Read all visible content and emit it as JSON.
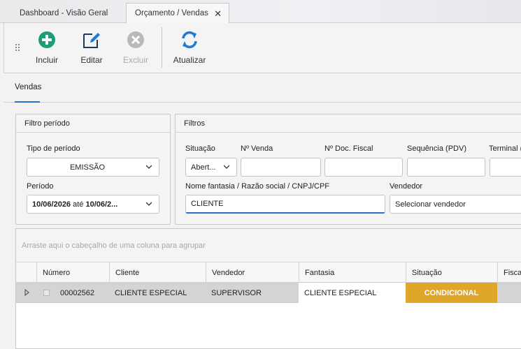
{
  "tabs": [
    {
      "label": "Dashboard - Visão Geral"
    },
    {
      "label": "Orçamento / Vendas",
      "close": "✕"
    }
  ],
  "toolbar": {
    "incluir": "Incluir",
    "editar": "Editar",
    "excluir": "Excluir",
    "atualizar": "Atualizar"
  },
  "page_tab": "Vendas",
  "periodo_group": {
    "title": "Filtro período",
    "tipo_label": "Tipo de período",
    "tipo_value": "EMISSÃO",
    "periodo_label": "Período",
    "periodo_from": "10/06/2026",
    "periodo_sep": " até ",
    "periodo_to": "10/06/2..."
  },
  "filtros_group": {
    "title": "Filtros",
    "situacao_label": "Situação",
    "situacao_value": "Abert...",
    "nvenda_label": "Nº Venda",
    "ndoc_label": "Nº Doc. Fiscal",
    "sequencia_label": "Sequência (PDV)",
    "terminal_label": "Terminal (",
    "nome_label": "Nome fantasia / Razão social / CNPJ/CPF",
    "nome_value": "CLIENTE",
    "vendedor_label": "Vendedor",
    "vendedor_value": "Selecionar vendedor"
  },
  "grid": {
    "group_hint": "Arraste aqui o cabeçalho de uma coluna para agrupar",
    "columns": [
      "Número",
      "Cliente",
      "Vendedor",
      "Fantasia",
      "Situação",
      "Fiscal"
    ],
    "rows": [
      {
        "numero": "00002562",
        "cliente": "CLIENTE ESPECIAL",
        "vendedor": "SUPERVISOR",
        "fantasia": "CLIENTE ESPECIAL",
        "situacao": "CONDICIONAL"
      }
    ]
  },
  "colors": {
    "accent": "#2a6fd0",
    "add": "#1e9e77",
    "refresh": "#1f7bd6",
    "condicional": "#e0a62a"
  },
  "icons": [
    "plus-circle-icon",
    "edit-icon",
    "x-circle-icon",
    "refresh-icon",
    "chevron-down-icon",
    "grip-icon",
    "row-indicator-icon"
  ]
}
